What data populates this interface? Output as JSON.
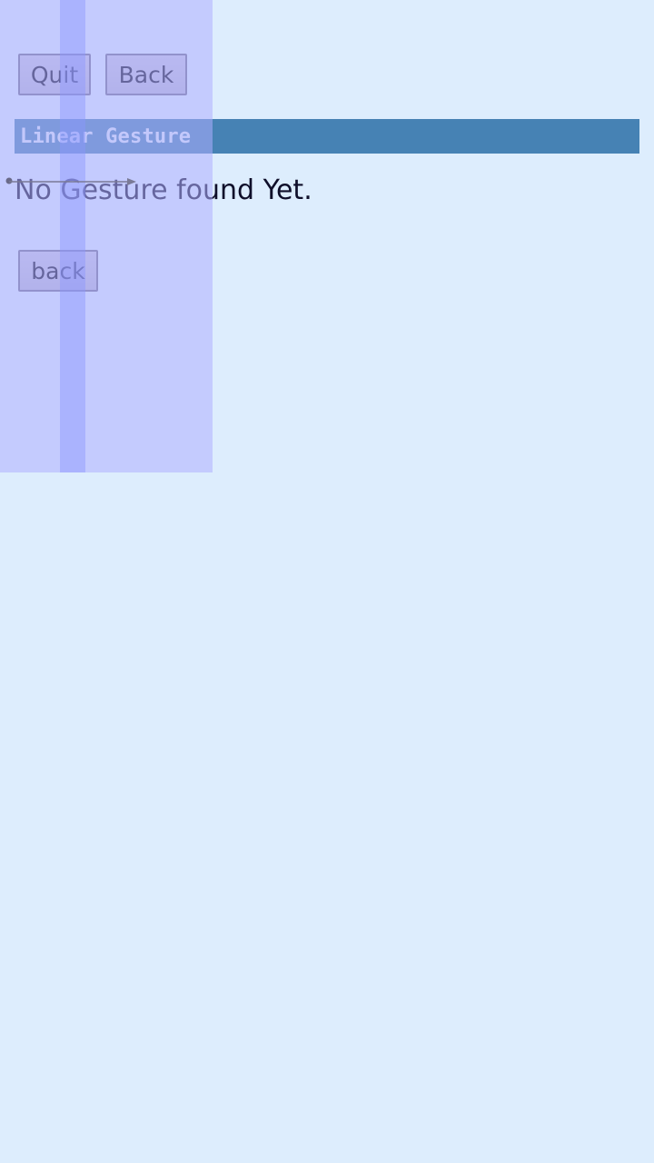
{
  "toolbar": {
    "quit_label": "Quit",
    "back_label": "Back"
  },
  "header": {
    "title": "Linear Gesture"
  },
  "main": {
    "status": "No Gesture found Yet.",
    "back_label": "back"
  },
  "overlay": {
    "gesture_indicator": "linear-gesture-arrow"
  },
  "colors": {
    "background": "#ddedfd",
    "title_bar": "#4682b4",
    "overlay": "#afafff"
  }
}
